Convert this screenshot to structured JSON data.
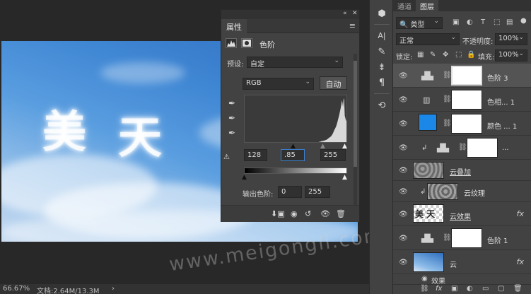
{
  "status": {
    "zoom": "66.67%",
    "doc_label": "文档:2.64M/13.3M",
    "nav_arrow": "›"
  },
  "image": {
    "cloud_text": [
      "美",
      "天"
    ],
    "watermark": "www.meigongli.com"
  },
  "properties": {
    "top_controls": [
      "«",
      "✕"
    ],
    "tab": "属性",
    "menu_icon": "≡",
    "title": "色阶",
    "preset_label": "预设:",
    "preset_value": "自定",
    "channel_value": "RGB",
    "auto_label": "自动",
    "input_black": "128",
    "input_gamma": ".85",
    "input_white": "255",
    "output_label": "输出色阶:",
    "output_black": "0",
    "output_white": "255",
    "histogram": [
      0,
      0,
      0,
      0,
      0,
      0,
      0,
      0,
      0,
      0,
      0,
      0,
      0,
      0,
      0,
      0,
      0,
      0,
      0,
      0,
      0,
      0,
      0,
      0,
      0,
      0,
      0,
      0,
      0,
      0,
      0,
      0,
      0,
      0,
      0,
      0,
      0,
      0,
      0,
      0,
      0,
      0,
      0,
      0,
      0,
      0,
      0,
      0,
      0,
      0,
      0,
      0,
      0,
      0,
      0,
      0,
      0,
      0,
      0,
      0,
      0,
      0,
      0,
      0,
      0,
      0,
      0,
      0,
      0,
      0,
      0,
      0,
      0,
      0,
      0,
      0,
      0,
      0,
      0,
      0,
      0,
      0,
      0,
      0,
      0,
      0,
      0,
      0,
      0,
      0,
      0,
      0,
      0,
      0,
      0,
      0,
      0,
      0,
      0,
      0,
      0,
      0,
      0,
      0,
      0,
      0,
      0,
      0,
      0,
      0,
      0,
      0,
      0,
      0,
      0,
      0,
      0,
      0,
      0,
      0,
      0,
      0,
      0,
      0,
      0,
      0,
      0,
      0,
      0,
      0,
      0,
      1,
      1,
      1,
      2,
      2,
      2,
      3,
      3,
      3,
      4,
      4,
      5,
      5,
      6,
      7,
      8,
      9,
      10,
      11,
      12,
      13,
      15,
      17,
      19,
      22,
      25,
      28,
      30,
      33,
      36,
      40,
      45,
      50,
      55,
      60,
      66,
      72,
      78,
      85,
      95,
      90,
      80,
      100,
      96,
      60,
      55,
      50,
      48
    ]
  },
  "layers_panel": {
    "tabs": [
      "通道",
      "图层"
    ],
    "filter_label": "类型",
    "blend_mode": "正常",
    "opacity_label": "不透明度:",
    "opacity_value": "100%",
    "lock_label": "锁定:",
    "fill_label": "填充:",
    "fill_value": "100%",
    "layers": [
      {
        "name": "色阶 3",
        "kind": "adjustment",
        "selected": true
      },
      {
        "name": "色相... 1",
        "kind": "adjustment"
      },
      {
        "name": "颜色 ... 1",
        "kind": "color",
        "color": "#1b87e6"
      },
      {
        "name": "...",
        "kind": "clipped-levels"
      },
      {
        "name": "云叠加",
        "kind": "cloud"
      },
      {
        "name": "云纹理",
        "kind": "clipped-cloud"
      },
      {
        "name": "云效果",
        "kind": "text",
        "fx": "fx"
      },
      {
        "name": "色阶 1",
        "kind": "adjustment"
      },
      {
        "name": "云",
        "kind": "sky",
        "fx": "fx"
      },
      {
        "name": "效果",
        "kind": "effect"
      }
    ],
    "footer_icons": [
      "⛓",
      "fx",
      "▣",
      "◐",
      "▭",
      "▢",
      "🗑"
    ]
  },
  "toolbar_icons": [
    "⬢",
    "A|",
    "✎",
    "⇟",
    "¶",
    "⟲"
  ],
  "colors": {
    "panel": "#424242",
    "dark": "#282828",
    "accent_blue": "#1b87e6",
    "selected_row": "#545454"
  }
}
